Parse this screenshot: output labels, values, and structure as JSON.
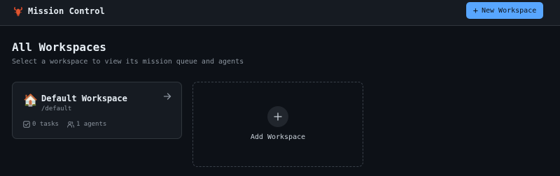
{
  "header": {
    "app_title": "Mission Control",
    "logo_icon": "lobster-icon",
    "new_workspace_plus": "+",
    "new_workspace_label": "New Workspace"
  },
  "main": {
    "title": "All Workspaces",
    "subtitle": "Select a workspace to view its mission queue and agents"
  },
  "workspaces": [
    {
      "emoji": "🏠",
      "name": "Default Workspace",
      "slug": "/default",
      "tasks": "0 tasks",
      "agents": "1 agents"
    }
  ],
  "add_card": {
    "label": "Add Workspace"
  },
  "colors": {
    "background": "#0d1117",
    "topbar": "#161b22",
    "accent": "#58a6ff",
    "border": "#30363d",
    "muted_text": "#8b949e"
  }
}
